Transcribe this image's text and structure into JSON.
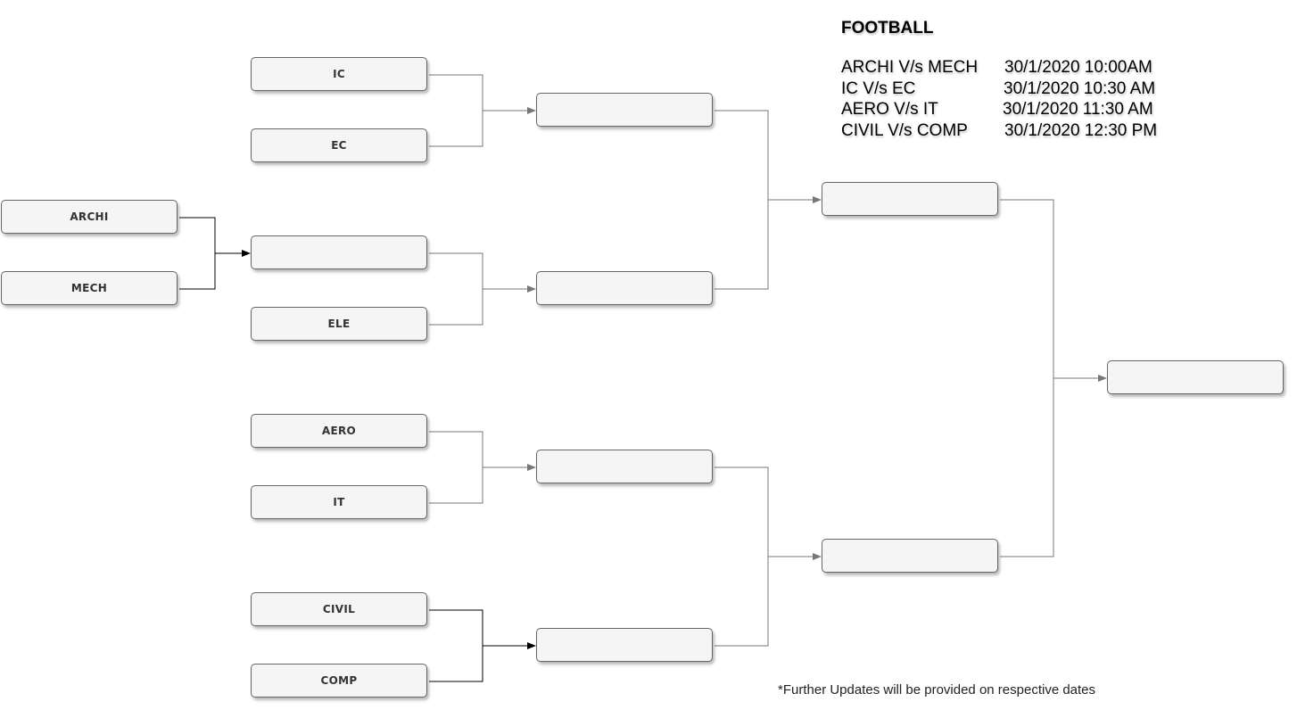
{
  "title": "FOOTBALL",
  "schedule": [
    {
      "match": "ARCHI V/s MECH",
      "when": "30/1/2020 10:00AM"
    },
    {
      "match": "IC V/s EC",
      "when": "30/1/2020  10:30 AM"
    },
    {
      "match": "AERO V/s IT",
      "when": "30/1/2020  11:30 AM"
    },
    {
      "match": "CIVIL V/s COMP",
      "when": "30/1/2020  12:30 PM"
    }
  ],
  "footnote": "*Further Updates will be provided on respective dates",
  "teams": {
    "ic": "IC",
    "ec": "EC",
    "archi": "ARCHI",
    "mech": "MECH",
    "ele": "ELE",
    "aero": "AERO",
    "it": "IT",
    "civil": "CIVIL",
    "comp": "COMP"
  },
  "colors": {
    "box_fill": "#f5f5f5",
    "box_border": "#666666",
    "connector_gray": "#777777",
    "connector_black": "#000000"
  }
}
